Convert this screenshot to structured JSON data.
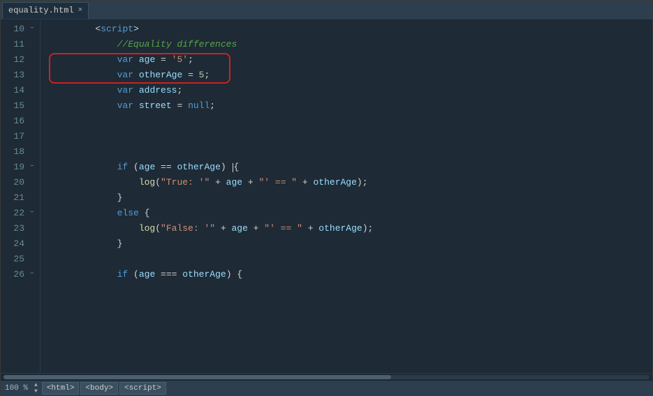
{
  "tab": {
    "filename": "equality.html",
    "close_label": "×"
  },
  "lines": [
    {
      "num": 10,
      "fold": "−",
      "tokens": [
        {
          "type": "plain",
          "text": "        "
        },
        {
          "type": "plain",
          "text": "<"
        },
        {
          "type": "kw",
          "text": "script"
        },
        {
          "type": "plain",
          "text": ">"
        }
      ]
    },
    {
      "num": 11,
      "fold": "",
      "tokens": [
        {
          "type": "comment",
          "text": "            //Equality differences"
        }
      ]
    },
    {
      "num": 12,
      "fold": "",
      "highlight": true,
      "tokens": [
        {
          "type": "plain",
          "text": "            "
        },
        {
          "type": "kw",
          "text": "var"
        },
        {
          "type": "plain",
          "text": " "
        },
        {
          "type": "var-name",
          "text": "age"
        },
        {
          "type": "plain",
          "text": " = "
        },
        {
          "type": "str",
          "text": "'5'"
        },
        {
          "type": "plain",
          "text": ";"
        }
      ]
    },
    {
      "num": 13,
      "fold": "",
      "highlight": true,
      "tokens": [
        {
          "type": "plain",
          "text": "            "
        },
        {
          "type": "kw",
          "text": "var"
        },
        {
          "type": "plain",
          "text": " "
        },
        {
          "type": "var-name",
          "text": "otherAge"
        },
        {
          "type": "plain",
          "text": " = "
        },
        {
          "type": "num",
          "text": "5"
        },
        {
          "type": "plain",
          "text": ";"
        }
      ]
    },
    {
      "num": 14,
      "fold": "",
      "tokens": [
        {
          "type": "plain",
          "text": "            "
        },
        {
          "type": "kw",
          "text": "var"
        },
        {
          "type": "plain",
          "text": " "
        },
        {
          "type": "var-name",
          "text": "address"
        },
        {
          "type": "plain",
          "text": ";"
        }
      ]
    },
    {
      "num": 15,
      "fold": "",
      "tokens": [
        {
          "type": "plain",
          "text": "            "
        },
        {
          "type": "kw",
          "text": "var"
        },
        {
          "type": "plain",
          "text": " "
        },
        {
          "type": "var-name",
          "text": "street"
        },
        {
          "type": "plain",
          "text": " = "
        },
        {
          "type": "null-kw",
          "text": "null"
        },
        {
          "type": "plain",
          "text": ";"
        }
      ]
    },
    {
      "num": 16,
      "fold": "",
      "tokens": []
    },
    {
      "num": 17,
      "fold": "",
      "tokens": []
    },
    {
      "num": 18,
      "fold": "",
      "tokens": []
    },
    {
      "num": 19,
      "fold": "−",
      "tokens": [
        {
          "type": "plain",
          "text": "            "
        },
        {
          "type": "kw",
          "text": "if"
        },
        {
          "type": "plain",
          "text": " ("
        },
        {
          "type": "var-name",
          "text": "age"
        },
        {
          "type": "plain",
          "text": " == "
        },
        {
          "type": "var-name",
          "text": "otherAge"
        },
        {
          "type": "plain",
          "text": ") "
        },
        {
          "type": "cursor",
          "text": ""
        },
        {
          "type": "plain",
          "text": "{"
        }
      ]
    },
    {
      "num": 20,
      "fold": "",
      "tokens": [
        {
          "type": "plain",
          "text": "                "
        },
        {
          "type": "fn",
          "text": "log"
        },
        {
          "type": "plain",
          "text": "("
        },
        {
          "type": "str",
          "text": "\"True: '\""
        },
        {
          "type": "plain",
          "text": " + "
        },
        {
          "type": "var-name",
          "text": "age"
        },
        {
          "type": "plain",
          "text": " + "
        },
        {
          "type": "str",
          "text": "\"' == \""
        },
        {
          "type": "plain",
          "text": " + "
        },
        {
          "type": "var-name",
          "text": "otherAge"
        },
        {
          "type": "plain",
          "text": ");"
        }
      ]
    },
    {
      "num": 21,
      "fold": "",
      "tokens": [
        {
          "type": "plain",
          "text": "            }"
        }
      ]
    },
    {
      "num": 22,
      "fold": "−",
      "tokens": [
        {
          "type": "plain",
          "text": "            "
        },
        {
          "type": "kw",
          "text": "else"
        },
        {
          "type": "plain",
          "text": " {"
        }
      ]
    },
    {
      "num": 23,
      "fold": "",
      "tokens": [
        {
          "type": "plain",
          "text": "                "
        },
        {
          "type": "fn",
          "text": "log"
        },
        {
          "type": "plain",
          "text": "("
        },
        {
          "type": "str",
          "text": "\"False: '\""
        },
        {
          "type": "plain",
          "text": " + "
        },
        {
          "type": "var-name",
          "text": "age"
        },
        {
          "type": "plain",
          "text": " + "
        },
        {
          "type": "str",
          "text": "\"' == \""
        },
        {
          "type": "plain",
          "text": " + "
        },
        {
          "type": "var-name",
          "text": "otherAge"
        },
        {
          "type": "plain",
          "text": ");"
        }
      ]
    },
    {
      "num": 24,
      "fold": "",
      "tokens": [
        {
          "type": "plain",
          "text": "            }"
        }
      ]
    },
    {
      "num": 25,
      "fold": "",
      "tokens": []
    },
    {
      "num": 26,
      "fold": "−",
      "tokens": [
        {
          "type": "plain",
          "text": "            "
        },
        {
          "type": "kw",
          "text": "if"
        },
        {
          "type": "plain",
          "text": " ("
        },
        {
          "type": "var-name",
          "text": "age"
        },
        {
          "type": "plain",
          "text": " === "
        },
        {
          "type": "var-name",
          "text": "otherAge"
        },
        {
          "type": "plain",
          "text": ") {"
        }
      ]
    }
  ],
  "status": {
    "zoom": "100 %",
    "breadcrumbs": [
      "<html>",
      "<body>",
      "<script>"
    ]
  }
}
